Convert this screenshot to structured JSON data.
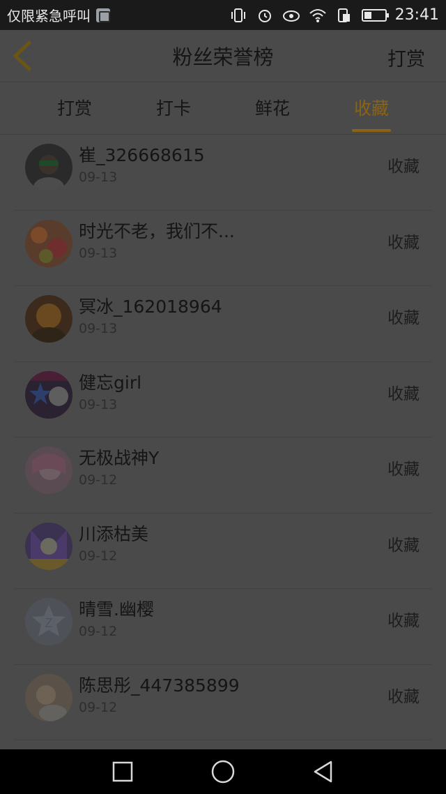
{
  "status_bar": {
    "carrier": "仅限紧急呼叫",
    "time": "23:41",
    "icons": [
      "vibrate-icon",
      "alarm-icon",
      "eye-icon",
      "wifi-icon",
      "data-icon",
      "battery-icon"
    ]
  },
  "header": {
    "title": "粉丝荣誉榜",
    "right_action": "打赏",
    "back_icon": "chevron-left-icon"
  },
  "tabs": [
    {
      "label": "打赏",
      "active": false
    },
    {
      "label": "打卡",
      "active": false
    },
    {
      "label": "鲜花",
      "active": false
    },
    {
      "label": "收藏",
      "active": true
    }
  ],
  "colors": {
    "accent": "#8a6414",
    "overlay": "#4a4a4a"
  },
  "list": [
    {
      "name": "崔_326668615",
      "date": "09-13",
      "action": "收藏"
    },
    {
      "name": "时光不老，我们不...",
      "date": "09-13",
      "action": "收藏"
    },
    {
      "name": "冥冰_162018964",
      "date": "09-13",
      "action": "收藏"
    },
    {
      "name": "健忘girl",
      "date": "09-13",
      "action": "收藏"
    },
    {
      "name": "无极战神Y",
      "date": "09-12",
      "action": "收藏"
    },
    {
      "name": "川添枯美",
      "date": "09-12",
      "action": "收藏"
    },
    {
      "name": "晴雪.幽樱",
      "date": "09-12",
      "action": "收藏"
    },
    {
      "name": "陈思彤_447385899",
      "date": "09-12",
      "action": "收藏"
    }
  ],
  "nav_bar": [
    "recent-apps-icon",
    "home-icon",
    "back-icon"
  ]
}
